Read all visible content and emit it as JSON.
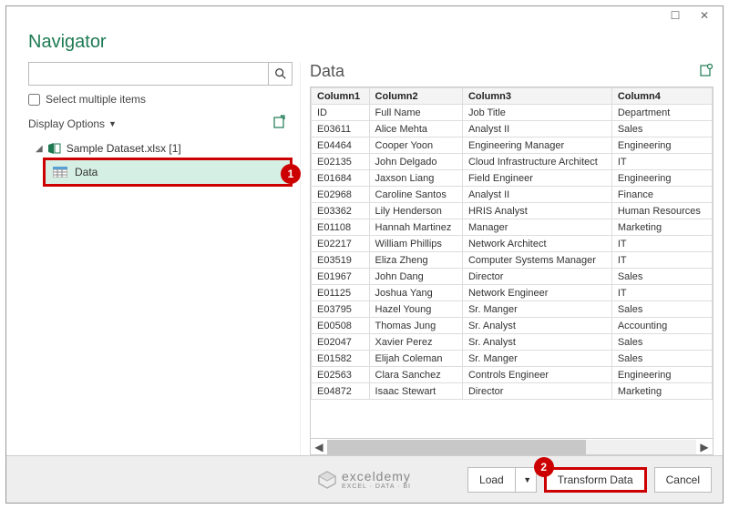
{
  "window": {
    "title": "Navigator"
  },
  "search": {
    "placeholder": ""
  },
  "selectMultiple": {
    "label": "Select multiple items"
  },
  "displayOptions": {
    "label": "Display Options"
  },
  "tree": {
    "file": "Sample Dataset.xlsx [1]",
    "table": "Data"
  },
  "preview": {
    "title": "Data",
    "columns": [
      "Column1",
      "Column2",
      "Column3",
      "Column4"
    ],
    "rows": [
      [
        "ID",
        "Full Name",
        "Job Title",
        "Department"
      ],
      [
        "E03611",
        "Alice Mehta",
        "Analyst II",
        "Sales"
      ],
      [
        "E04464",
        "Cooper Yoon",
        "Engineering Manager",
        "Engineering"
      ],
      [
        "E02135",
        "John Delgado",
        "Cloud Infrastructure Architect",
        "IT"
      ],
      [
        "E01684",
        "Jaxson Liang",
        "Field Engineer",
        "Engineering"
      ],
      [
        "E02968",
        "Caroline Santos",
        "Analyst II",
        "Finance"
      ],
      [
        "E03362",
        "Lily Henderson",
        "HRIS Analyst",
        "Human Resources"
      ],
      [
        "E01108",
        "Hannah Martinez",
        "Manager",
        "Marketing"
      ],
      [
        "E02217",
        "William Phillips",
        "Network Architect",
        "IT"
      ],
      [
        "E03519",
        "Eliza Zheng",
        "Computer Systems Manager",
        "IT"
      ],
      [
        "E01967",
        "John Dang",
        "Director",
        "Sales"
      ],
      [
        "E01125",
        "Joshua Yang",
        "Network Engineer",
        "IT"
      ],
      [
        "E03795",
        "Hazel Young",
        "Sr. Manger",
        "Sales"
      ],
      [
        "E00508",
        "Thomas Jung",
        "Sr. Analyst",
        "Accounting"
      ],
      [
        "E02047",
        "Xavier Perez",
        "Sr. Analyst",
        "Sales"
      ],
      [
        "E01582",
        "Elijah Coleman",
        "Sr. Manger",
        "Sales"
      ],
      [
        "E02563",
        "Clara Sanchez",
        "Controls Engineer",
        "Engineering"
      ],
      [
        "E04872",
        "Isaac Stewart",
        "Director",
        "Marketing"
      ]
    ]
  },
  "footer": {
    "brand": "exceldemy",
    "brandSub": "EXCEL · DATA · BI",
    "load": "Load",
    "transform": "Transform Data",
    "cancel": "Cancel"
  },
  "callouts": {
    "one": "1",
    "two": "2"
  }
}
